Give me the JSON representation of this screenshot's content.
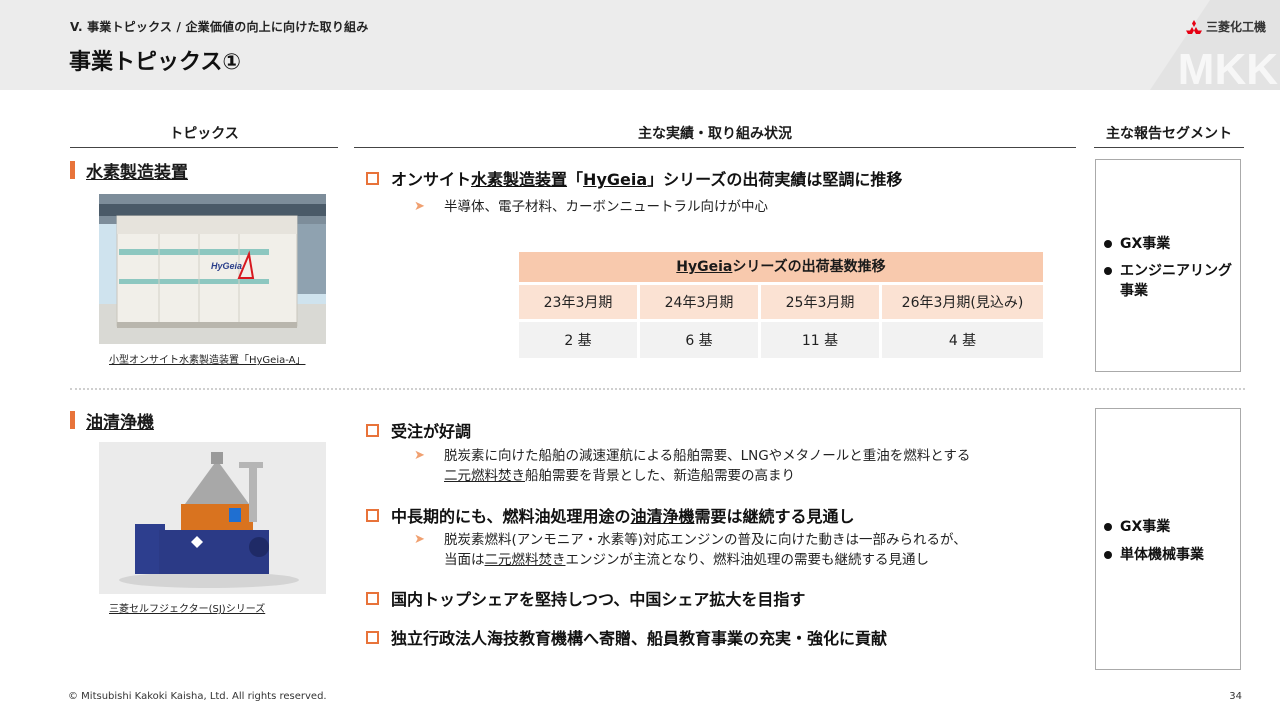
{
  "header": {
    "breadcrumb": "V. 事業トピックス / 企業価値の向上に向けた取り組み",
    "title": "事業トピックス①",
    "logo_text": "三菱化工機",
    "watermark": "MKK"
  },
  "columns": {
    "topics": "トピックス",
    "status": "主な実績・取り組み状況",
    "segment": "主な報告セグメント"
  },
  "section1": {
    "title": "水素製造装置",
    "photo_label": "HyGeia",
    "caption": "小型オンサイト水素製造装置「HyGeia-A」",
    "bullet1": {
      "pre": "オンサイト",
      "ul": "水素製造装置",
      "mid": "「",
      "brand": "HyGeia",
      "post": "」シリーズの出荷実績は堅調に推移"
    },
    "sub1": "半導体、電子材料、カーボンニュートラル向けが中心",
    "table": {
      "title_brand": "HyGeia",
      "title_rest": "シリーズの出荷基数推移",
      "headers": [
        "23年3月期",
        "24年3月期",
        "25年3月期",
        "26年3月期(見込み)"
      ],
      "values": [
        "2 基",
        "6 基",
        "11 基",
        "4 基"
      ]
    },
    "segments": [
      "GX事業",
      "エンジニアリング事業"
    ]
  },
  "section2": {
    "title": "油清浄機",
    "caption": "三菱セルフジェクター(SJ)シリーズ",
    "bullet1": "受注が好調",
    "sub1_line1": "脱炭素に向けた船舶の減速運航による船舶需要、LNGやメタノールと重油を燃料とする",
    "sub1_line2_ul": "二元燃料焚き",
    "sub1_line2_rest": "船舶需要を背景とした、新造船需要の高まり",
    "bullet2_pre": "中長期的にも、燃料油処理用途の",
    "bullet2_ul": "油清浄機",
    "bullet2_post": "需要は継続する見通し",
    "sub2_line1": "脱炭素燃料(アンモニア・水素等)対応エンジンの普及に向けた動きは一部みられるが、",
    "sub2_line2_pre": "当面は",
    "sub2_line2_ul": "二元燃料焚き",
    "sub2_line2_rest": "エンジンが主流となり、燃料油処理の需要も継続する見通し",
    "bullet3": "国内トップシェアを堅持しつつ、中国シェア拡大を目指す",
    "bullet4": "独立行政法人海技教育機構へ寄贈、船員教育事業の充実・強化に貢献",
    "segments": [
      "GX事業",
      "単体機械事業"
    ]
  },
  "footer": {
    "copyright": "© Mitsubishi Kakoki Kaisha, Ltd. All rights reserved.",
    "page": "34"
  },
  "colors": {
    "accent": "#e8733a",
    "table_title": "#f8c9ad",
    "table_head": "#fbe2d3"
  }
}
